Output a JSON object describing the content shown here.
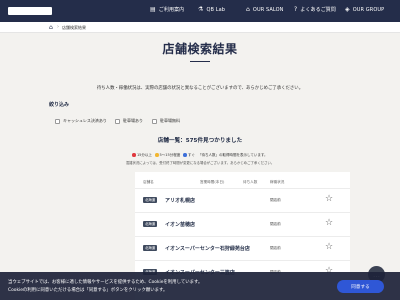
{
  "header": {
    "nav": [
      {
        "label": "ご利用案内",
        "icon": "document-icon"
      },
      {
        "label": "QB Lab",
        "icon": "flask-icon"
      },
      {
        "label": "OUR SALON",
        "icon": "shop-icon"
      },
      {
        "label": "よくあるご質問",
        "icon": "question-icon"
      },
      {
        "label": "OUR GROUP",
        "icon": "group-icon"
      }
    ]
  },
  "breadcrumb": {
    "current": "店舗検索結果"
  },
  "page": {
    "title": "店舗検索結果",
    "intro": "待ち人数・稼働状況は、実際の店舗の状況と異なることがございますので、あらかじめご了承ください。"
  },
  "filter": {
    "label": "絞り込み",
    "chips": [
      {
        "label": "キャッシュレス決済あり"
      },
      {
        "label": "駐車場あり"
      },
      {
        "label": "駐車場無料"
      }
    ]
  },
  "list": {
    "title": "店舗一覧：575件見つかりました",
    "legend": [
      {
        "label": "15分以上",
        "color": "#e0383e"
      },
      {
        "label": "5〜15分程度",
        "color": "#f2b630"
      },
      {
        "label": "すぐ",
        "color": "#3d6fd9"
      },
      {
        "label": "「待ち人数」の取得時間を表示しています。",
        "color": ""
      }
    ],
    "note": "混雑状況によっては、受付終了時間が変更になる場合がございます。あらかじめご了承ください。",
    "columns": {
      "name": "店舗名",
      "hours": "営業時間(本日)",
      "waiting": "待ち人数",
      "status": "稼働状況"
    },
    "rows": [
      {
        "badge": "北海道",
        "name": "アリオ札幌店",
        "status": "閉店前"
      },
      {
        "badge": "北海道",
        "name": "イオン苗穂店",
        "status": "閉店前"
      },
      {
        "badge": "北海道",
        "name": "イオンスーパーセンター石狩緑苑台店",
        "status": "閉店前"
      },
      {
        "badge": "北海道",
        "name": "イオンスーパーセンター三笠店",
        "status": "閉店前"
      }
    ]
  },
  "cookie": {
    "line1": "当ウェブサイトでは、お客様に適した情報やサービスを提供するため、Cookieを利用しています。",
    "line2": "Cookieの利用に同意いただける場合は「同意する」ボタンをクリック願います。",
    "agree": "同意する"
  },
  "colors": {
    "header": "#242d4a",
    "accent": "#2f57d6",
    "badge": "#3f4a5e"
  }
}
